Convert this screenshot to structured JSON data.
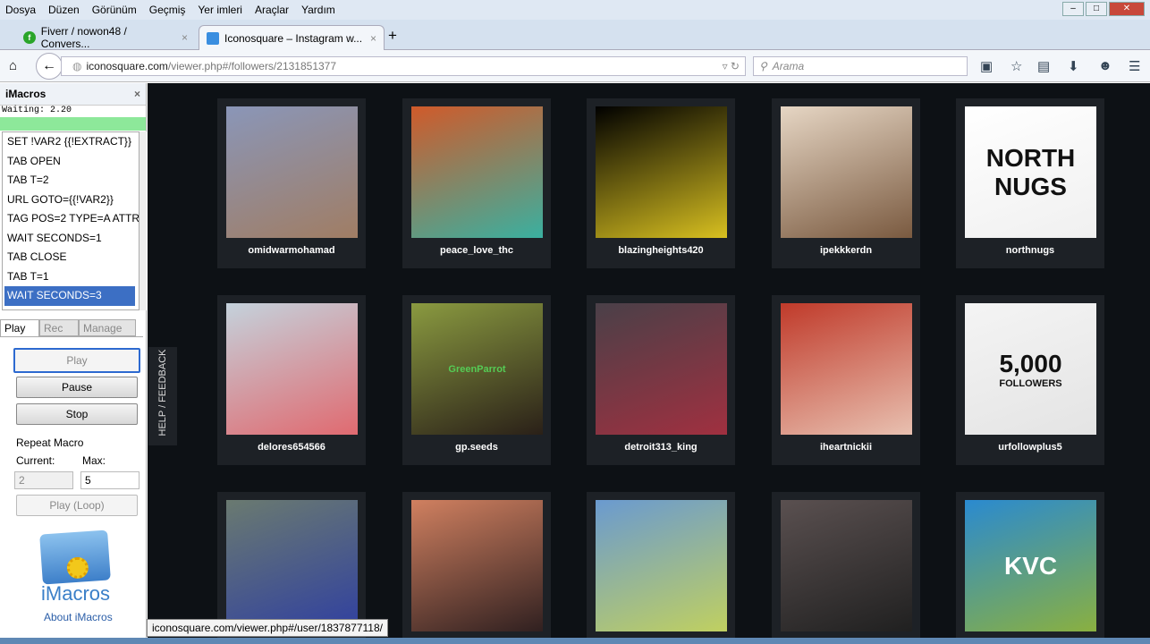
{
  "menu": [
    "Dosya",
    "Düzen",
    "Görünüm",
    "Geçmiş",
    "Yer imleri",
    "Araçlar",
    "Yardım"
  ],
  "tabs": [
    {
      "label": "Fiverr / nowon48 / Convers...",
      "icon": "fiverr-icon"
    },
    {
      "label": "Iconosquare – Instagram w...",
      "icon": "iconosquare-icon"
    }
  ],
  "url": {
    "domain": "iconosquare.com",
    "path": "/viewer.php#/followers/2131851377"
  },
  "search": {
    "placeholder": "Arama"
  },
  "imacros": {
    "title": "iMacros",
    "status": "Waiting: 2.20",
    "progress": 1.0,
    "lines": [
      "SET !VAR2 {{!EXTRACT}}",
      "TAB OPEN",
      "TAB T=2",
      "URL GOTO={{!VAR2}}",
      "TAG POS=2 TYPE=A ATTR...",
      "WAIT SECONDS=1",
      "TAB CLOSE",
      "TAB T=1",
      "WAIT SECONDS=3"
    ],
    "selected_line": 8,
    "tabs": [
      "Play",
      "Rec",
      "Manage"
    ],
    "buttons": {
      "play": "Play",
      "pause": "Pause",
      "stop": "Stop",
      "loop": "Play (Loop)"
    },
    "repeat_label": "Repeat Macro",
    "current_label": "Current:",
    "max_label": "Max:",
    "current": "2",
    "max": "5",
    "logo_text": "iMacros",
    "about": "About iMacros"
  },
  "help": "HELP / FEEDBACK",
  "followers": [
    {
      "name": "omidwarmohamad",
      "colors": [
        "#8a96b8",
        "#a07d64"
      ]
    },
    {
      "name": "peace_love_thc",
      "colors": [
        "#d05a2a",
        "#3ab0a0"
      ]
    },
    {
      "name": "blazingheights420",
      "colors": [
        "#000000",
        "#d8c020"
      ]
    },
    {
      "name": "ipekkkerdn",
      "colors": [
        "#e6d6c4",
        "#7a5a40"
      ]
    },
    {
      "name": "northnugs",
      "colors": [
        "#ffffff",
        "#f0f0f0"
      ],
      "overlay": [
        "NORTH",
        "NUGS"
      ]
    },
    {
      "name": "delores654566",
      "colors": [
        "#c4d2dc",
        "#e06a70"
      ]
    },
    {
      "name": "gp.seeds",
      "colors": [
        "#8a9a40",
        "#2a2018"
      ],
      "overlay": [
        "GreenParrot"
      ]
    },
    {
      "name": "detroit313_king",
      "colors": [
        "#4a4048",
        "#a03040"
      ]
    },
    {
      "name": "iheartnickii",
      "colors": [
        "#c03a2a",
        "#e8c0b0"
      ]
    },
    {
      "name": "urfollowplus5",
      "colors": [
        "#f4f4f4",
        "#e4e4e4"
      ],
      "overlay": [
        "5,000",
        "FOLLOWERS"
      ]
    },
    {
      "name": "",
      "colors": [
        "#6a7a70",
        "#3040a0"
      ]
    },
    {
      "name": "",
      "colors": [
        "#d08060",
        "#302020"
      ]
    },
    {
      "name": "",
      "colors": [
        "#6a9ad0",
        "#c0d060"
      ]
    },
    {
      "name": "",
      "colors": [
        "#5a5050",
        "#202020"
      ]
    },
    {
      "name": "",
      "colors": [
        "#2a8ad0",
        "#8ab040"
      ],
      "overlay": [
        "KVC"
      ]
    }
  ],
  "tooltip": "iconosquare.com/viewer.php#/user/1837877118/"
}
